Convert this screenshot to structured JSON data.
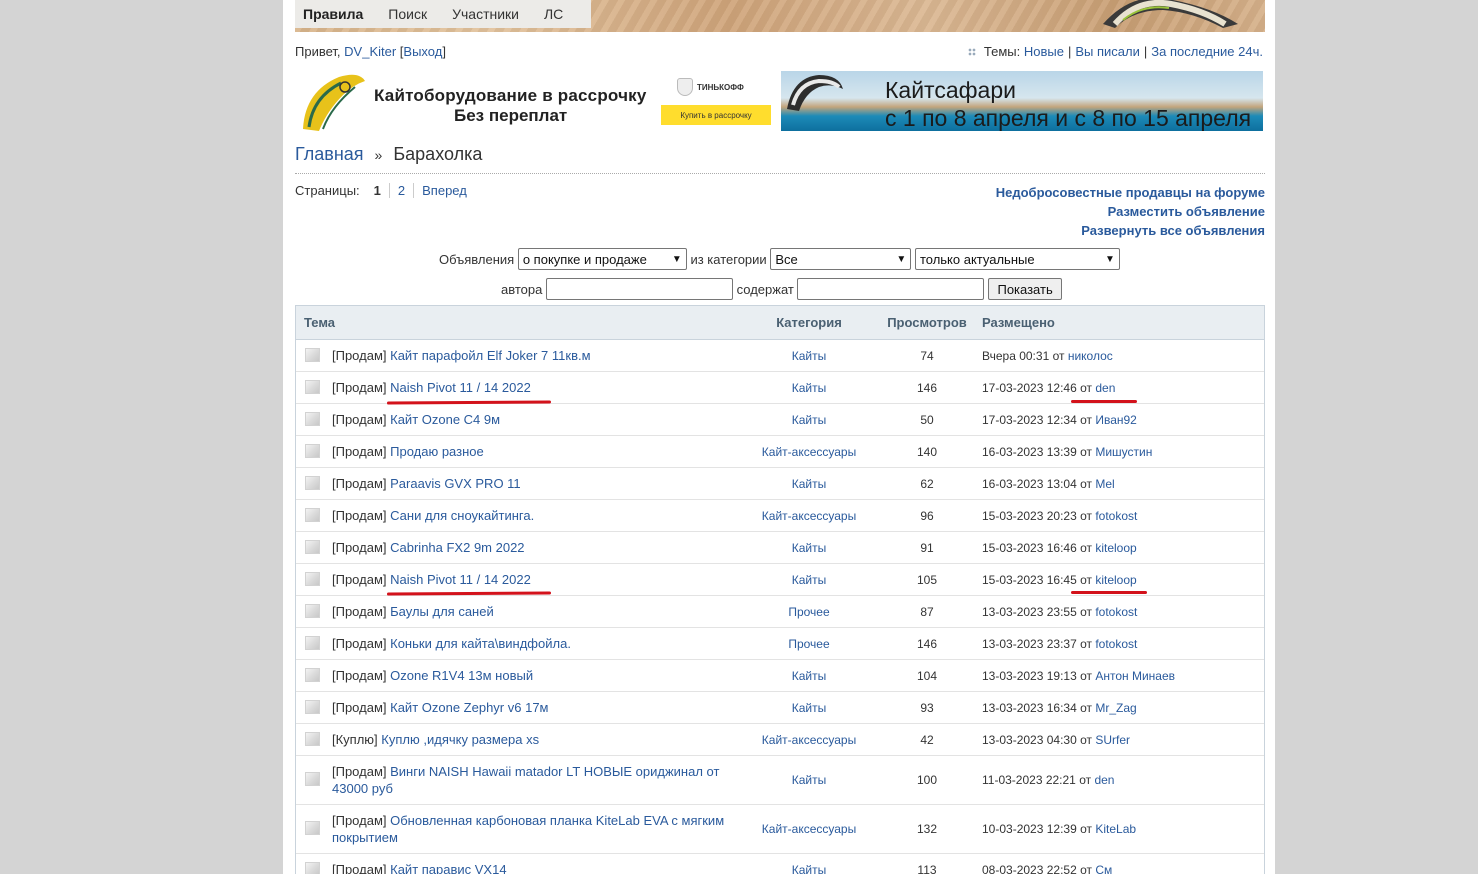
{
  "nav": {
    "items": [
      "Правила",
      "Поиск",
      "Участники",
      "ЛС"
    ]
  },
  "greeting": {
    "hello": "Привет,",
    "user": "DV_Kiter",
    "logout": "Выход"
  },
  "themes": {
    "label": "Темы:",
    "new": "Новые",
    "wrote": "Вы писали",
    "last24": "За последние 24ч."
  },
  "ads": {
    "left": {
      "line1": "Кайтоборудование в рассрочку",
      "line2": "Без переплат",
      "bank": "ТИНЬКОФФ",
      "button": "Купить в рассрочку"
    },
    "right": {
      "title": "Кайтсафари",
      "subtitle": "с 1 по 8 апреля и с 8 по 15 апреля"
    }
  },
  "breadcrumb": {
    "home": "Главная",
    "sep": "»",
    "current": "Барахолка"
  },
  "pager": {
    "label": "Страницы:",
    "current": "1",
    "page2": "2",
    "next": "Вперед"
  },
  "right_links": [
    "Недобросовестные продавцы на форуме",
    "Разместить объявление",
    "Развернуть все объявления"
  ],
  "filters": {
    "ads_label": "Объявления",
    "type_value": "о покупке и продаже",
    "category_label": "из категории",
    "category_value": "Все",
    "status_value": "только актуальные",
    "author_label": "автора",
    "contains_label": "содержат",
    "show_button": "Показать"
  },
  "table": {
    "headers": {
      "topic": "Тема",
      "category": "Категория",
      "views": "Просмотров",
      "posted": "Размещено"
    },
    "from": "от",
    "rows": [
      {
        "prefix": "[Продам]",
        "title": "Кайт парафойл Elf Joker 7 11кв.м",
        "category": "Кайты",
        "views": "74",
        "date": "Вчера 00:31",
        "author": "николос"
      },
      {
        "prefix": "[Продам]",
        "title": "Naish Pivot 11 / 14 2022",
        "category": "Кайты",
        "views": "146",
        "date": "17-03-2023 12:46",
        "author": "den"
      },
      {
        "prefix": "[Продам]",
        "title": "Кайт Ozone C4 9м",
        "category": "Кайты",
        "views": "50",
        "date": "17-03-2023 12:34",
        "author": "Иван92"
      },
      {
        "prefix": "[Продам]",
        "title": "Продаю разное",
        "category": "Кайт-аксессуары",
        "views": "140",
        "date": "16-03-2023 13:39",
        "author": "Мишустин"
      },
      {
        "prefix": "[Продам]",
        "title": "Paraavis GVX PRO 11",
        "category": "Кайты",
        "views": "62",
        "date": "16-03-2023 13:04",
        "author": "Mel"
      },
      {
        "prefix": "[Продам]",
        "title": "Сани для сноукайтинга.",
        "category": "Кайт-аксессуары",
        "views": "96",
        "date": "15-03-2023 20:23",
        "author": "fotokost"
      },
      {
        "prefix": "[Продам]",
        "title": "Cabrinha FX2 9m 2022",
        "category": "Кайты",
        "views": "91",
        "date": "15-03-2023 16:46",
        "author": "kiteloop"
      },
      {
        "prefix": "[Продам]",
        "title": "Naish Pivot 11 / 14 2022",
        "category": "Кайты",
        "views": "105",
        "date": "15-03-2023 16:45",
        "author": "kiteloop"
      },
      {
        "prefix": "[Продам]",
        "title": "Баулы для саней",
        "category": "Прочее",
        "views": "87",
        "date": "13-03-2023 23:55",
        "author": "fotokost"
      },
      {
        "prefix": "[Продам]",
        "title": "Коньки для кайта\\виндфойла.",
        "category": "Прочее",
        "views": "146",
        "date": "13-03-2023 23:37",
        "author": "fotokost"
      },
      {
        "prefix": "[Продам]",
        "title": "Ozone R1V4 13м новый",
        "category": "Кайты",
        "views": "104",
        "date": "13-03-2023 19:13",
        "author": "Антон Минаев"
      },
      {
        "prefix": "[Продам]",
        "title": "Кайт Ozone Zephyr v6 17м",
        "category": "Кайты",
        "views": "93",
        "date": "13-03-2023 16:34",
        "author": "Mr_Zag"
      },
      {
        "prefix": "[Куплю]",
        "title": "Куплю ,идячку размера xs",
        "category": "Кайт-аксессуары",
        "views": "42",
        "date": "13-03-2023 04:30",
        "author": "SUrfer"
      },
      {
        "prefix": "[Продам]",
        "title": "Винги NAISH Hawaii matador LT НОВЫЕ ориджинал от 43000 руб",
        "category": "Кайты",
        "views": "100",
        "date": "11-03-2023 22:21",
        "author": "den"
      },
      {
        "prefix": "[Продам]",
        "title": "Обновленная карбоновая планка KiteLab EVA с мягким покрытием",
        "category": "Кайт-аксессуары",
        "views": "132",
        "date": "10-03-2023 12:39",
        "author": "KiteLab"
      },
      {
        "prefix": "[Продам]",
        "title": "Кайт паравис VX14",
        "category": "Кайты",
        "views": "113",
        "date": "08-03-2023 22:52",
        "author": "Cм"
      }
    ]
  },
  "colors": {
    "link": "#2a5a9c",
    "header_bg": "#e9eef2",
    "annotation": "#d3121b"
  }
}
